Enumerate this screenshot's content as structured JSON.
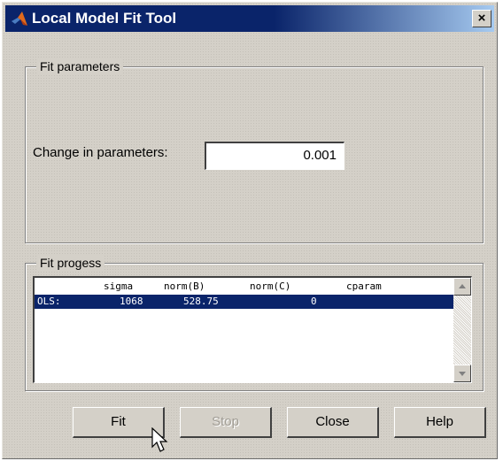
{
  "window": {
    "title": "Local Model Fit Tool",
    "close_glyph": "×"
  },
  "fit_parameters": {
    "group_title": "Fit parameters",
    "change_label": "Change in parameters:",
    "change_value": "0.001"
  },
  "fit_progress": {
    "group_title": "Fit progess",
    "columns": [
      "sigma",
      "norm(B)",
      "norm(C)",
      "cparam"
    ],
    "rows": [
      {
        "name": "OLS:",
        "sigma": "1068",
        "normB": "528.75",
        "normC": "0",
        "cparam": ""
      }
    ]
  },
  "buttons": {
    "fit": "Fit",
    "stop": "Stop",
    "close": "Close",
    "help": "Help"
  },
  "colors": {
    "titlebar": "#0a246a",
    "selection": "#0a246a",
    "face": "#d4d0c8"
  },
  "icons": {
    "app": "matlab-logo-icon",
    "close": "close-icon",
    "scroll_up": "scroll-up-arrow-icon",
    "scroll_down": "scroll-down-arrow-icon",
    "cursor": "mouse-pointer-icon"
  }
}
